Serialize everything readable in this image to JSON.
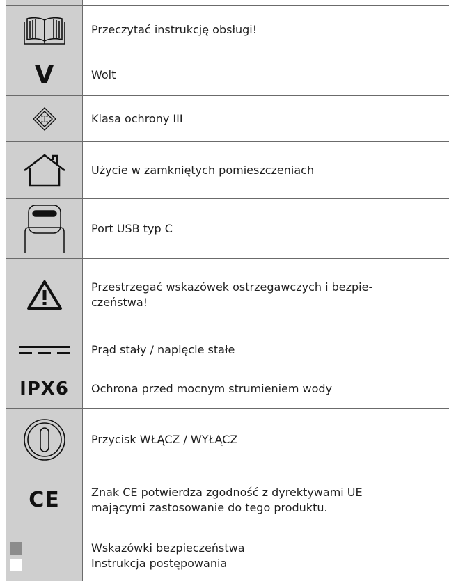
{
  "symbols": [
    {
      "icon": "open-book-icon",
      "text": "Przeczytać instrukcję obsługi!"
    },
    {
      "icon": "volt-icon",
      "symbol": "V",
      "text": "Wolt"
    },
    {
      "icon": "protection-class-iii-icon",
      "symbol": "III",
      "text": "Klasa ochrony III"
    },
    {
      "icon": "house-icon",
      "text": "Użycie w zamkniętych pomieszczeniach"
    },
    {
      "icon": "usb-c-port-icon",
      "text": "Port USB typ C"
    },
    {
      "icon": "warning-triangle-icon",
      "text": "Przestrzegać wskazówek ostrzegawczych i bezpie-\nczeństwa!"
    },
    {
      "icon": "direct-current-icon",
      "text": "Prąd stały / napięcie stałe"
    },
    {
      "icon": "ipx6-icon",
      "symbol": "IPX6",
      "text": "Ochrona przed mocnym strumieniem wody"
    },
    {
      "icon": "power-button-icon",
      "text": "Przycisk WŁĄCZ / WYŁĄCZ"
    },
    {
      "icon": "ce-mark-icon",
      "symbol": "CE",
      "text": "Znak CE potwierdza zgodność z dyrektywami UE\nmającymi zastosowanie do tego produktu."
    },
    {
      "icon": "legend-squares-icon",
      "lines": [
        "Wskazówki bezpieczeństwa",
        "Instrukcja postępowania"
      ]
    }
  ]
}
